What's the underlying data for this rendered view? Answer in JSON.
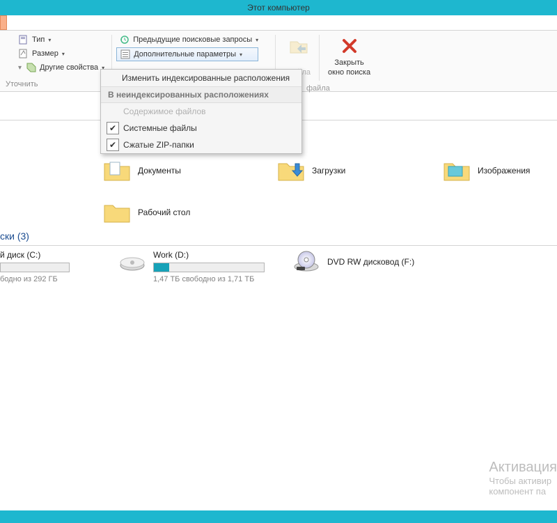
{
  "title": "Этот компьютер",
  "ribbon": {
    "type": "Тип",
    "size": "Размер",
    "other_props": "Другие свойства",
    "refine": "Уточнить",
    "prev_searches": "Предыдущие поисковые запросы",
    "adv_params": "Дополнительные параметры",
    "open_line2": "файла",
    "close_line1": "Закрыть",
    "close_line2": "окно поиска"
  },
  "dropdown": {
    "change_indexed": "Изменить индексированные расположения",
    "nonindexed_header": "В неиндексированных расположениях",
    "file_contents": "Содержимое файлов",
    "system_files": "Системные файлы",
    "zip_folders": "Сжатые ZIP-папки"
  },
  "folders": {
    "documents": "Документы",
    "downloads": "Загрузки",
    "pictures": "Изображения",
    "desktop": "Рабочий стол"
  },
  "drives_section": "ски (3)",
  "drives": {
    "c": {
      "name": "й диск (C:)",
      "free": "бодно из 292 ГБ"
    },
    "d": {
      "name": "Work (D:)",
      "free": "1,47 ТБ свободно из 1,71 ТБ"
    },
    "f": {
      "name": "DVD RW дисковод (F:)"
    }
  },
  "watermark": {
    "l1": "Активация",
    "l2": "Чтобы активир",
    "l3": "компонент па"
  }
}
